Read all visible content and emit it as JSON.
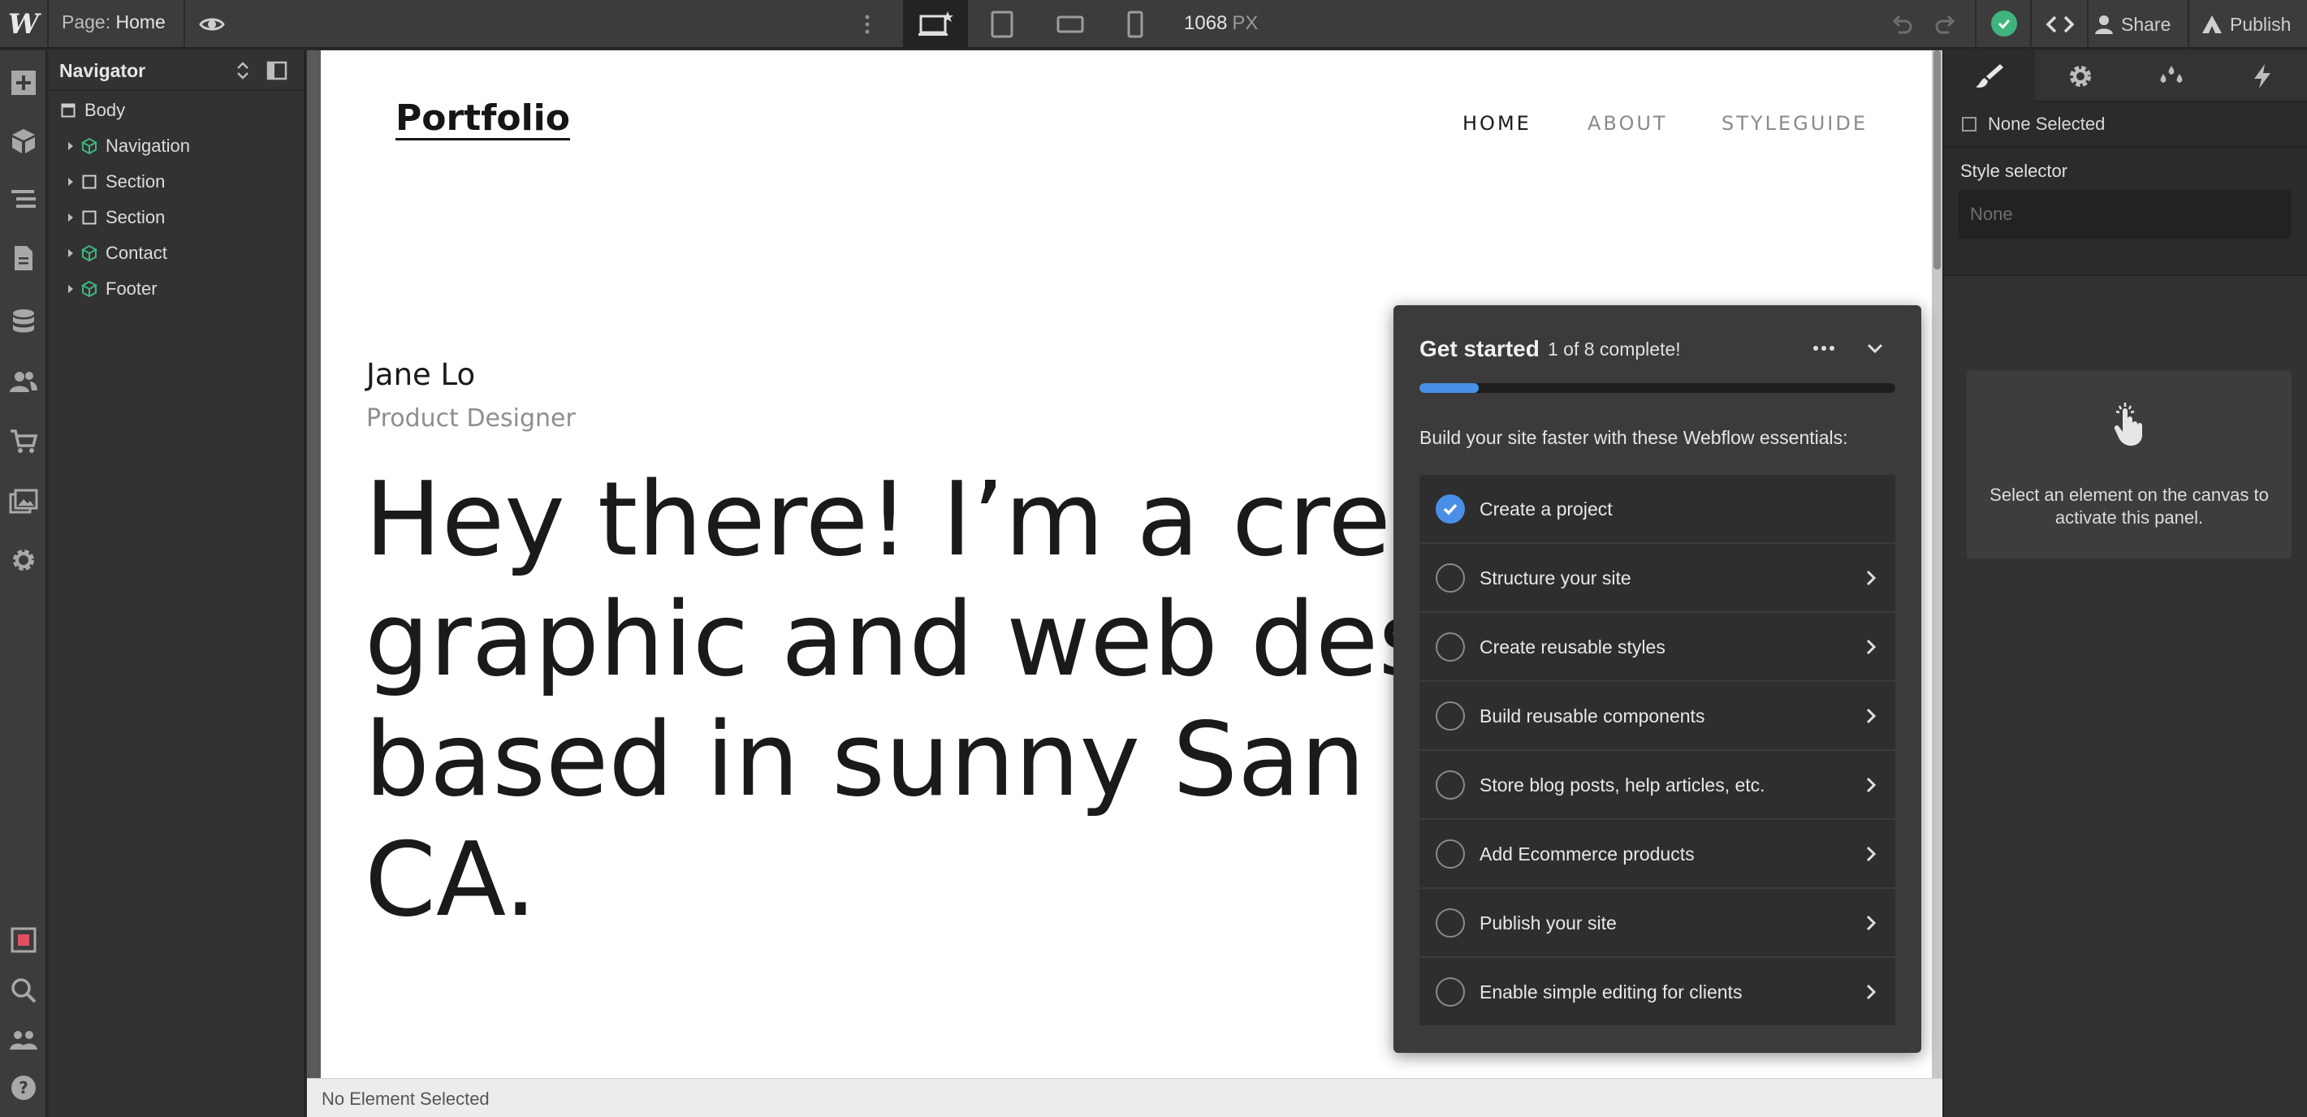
{
  "topbar": {
    "logo": "W",
    "page_prefix": "Page:",
    "page_name": "Home",
    "canvas_width_value": "1068",
    "canvas_width_unit": "PX",
    "share_label": "Share",
    "publish_label": "Publish",
    "icons": [
      "preview-eye-icon",
      "more-vertical-icon",
      "desktop-breakpoint-icon",
      "tablet-icon",
      "mobile-landscape-icon",
      "mobile-portrait-icon",
      "undo-icon",
      "redo-icon",
      "check-icon",
      "code-icon",
      "user-icon",
      "publish-icon"
    ],
    "accent_status": "#3fb47c"
  },
  "rail": {
    "icons": [
      "add-icon",
      "components-icon",
      "navigator-icon",
      "pages-icon",
      "cms-icon",
      "users-icon",
      "ecommerce-icon",
      "assets-icon",
      "settings-icon",
      "audit-icon",
      "search-icon",
      "team-icon",
      "help-icon"
    ]
  },
  "navigator": {
    "title": "Navigator",
    "items": [
      {
        "label": "Body",
        "type": "box"
      },
      {
        "label": "Navigation",
        "type": "component"
      },
      {
        "label": "Section",
        "type": "box"
      },
      {
        "label": "Section",
        "type": "box"
      },
      {
        "label": "Contact",
        "type": "component"
      },
      {
        "label": "Footer",
        "type": "component"
      }
    ]
  },
  "site": {
    "logo": "Portfolio",
    "nav": [
      "HOME",
      "ABOUT",
      "STYLEGUIDE"
    ],
    "name": "Jane Lo",
    "role": "Product Designer",
    "hero_lines": [
      "Hey there! I’m a creat",
      "graphic and web desi",
      "based in sunny San F",
      "CA."
    ]
  },
  "statusbar": {
    "text": "No Element Selected"
  },
  "get_started": {
    "title": "Get started",
    "count": "1 of 8 complete!",
    "progress": 0.125,
    "subtitle": "Build your site faster with these Webflow essentials:",
    "accent": "#4a8fe7",
    "items": [
      {
        "label": "Create a project",
        "done": true
      },
      {
        "label": "Structure your site",
        "done": false
      },
      {
        "label": "Create reusable styles",
        "done": false
      },
      {
        "label": "Build reusable components",
        "done": false
      },
      {
        "label": "Store blog posts, help articles, etc.",
        "done": false
      },
      {
        "label": "Add Ecommerce products",
        "done": false
      },
      {
        "label": "Publish your site",
        "done": false
      },
      {
        "label": "Enable simple editing for clients",
        "done": false
      }
    ]
  },
  "right_panel": {
    "tabs": [
      "style-brush-icon",
      "element-settings-icon",
      "style-manager-icon",
      "interactions-icon"
    ],
    "none_selected": "None Selected",
    "style_selector_label": "Style selector",
    "style_selector_placeholder": "None",
    "empty_message": "Select an element on the canvas to activate this panel."
  }
}
